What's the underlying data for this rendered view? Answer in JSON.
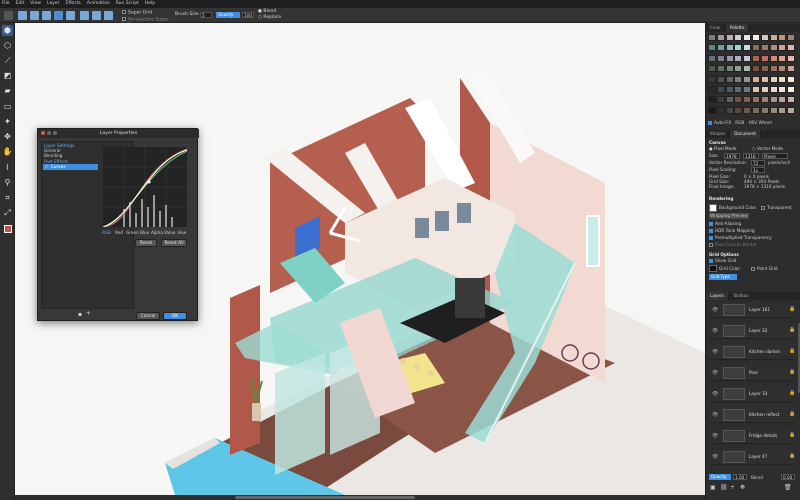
{
  "menu": [
    "File",
    "Edit",
    "View",
    "Layer",
    "Effects",
    "Animation",
    "Run Script",
    "Help"
  ],
  "options": {
    "super_grid": "Super Grid",
    "perspective_super_grid": "Perspective Super Grid",
    "brush_size_label": "Brush Size",
    "brush_size_value": "5",
    "opacity_label": "Opacity",
    "opacity_value": "100",
    "blend_label": "Blend",
    "replace_label": "Replace"
  },
  "panel": {
    "top_tabs": [
      "Color",
      "Palette"
    ],
    "color_modes": {
      "autofill": "Auto-Fill",
      "rgb": "RGB",
      "hsv": "HSV Wheel"
    },
    "mid_tabs": [
      "Shapes",
      "Document"
    ],
    "canvas_header": "Canvas",
    "pixel_mode": "Pixel Mode",
    "vector_mode": "Vector Mode",
    "size_label": "Size:",
    "size_w": "1978",
    "size_h": "1316",
    "size_unit": "Pixels",
    "vector_res_label": "Vector Resolution:",
    "vector_res_value": "72",
    "vector_res_unit": "pixels/inch",
    "pixel_scaling_label": "Pixel Scaling:",
    "pixel_scaling_value": "1x",
    "pixel_size_label": "Pixel Size:",
    "pixel_size_value": "0 × 0 pixels",
    "grid_size_label": "Grid Size:",
    "grid_size_value": "490 × 393 Pixels",
    "final_image_label": "Final Image:",
    "final_image_value": "1978 × 1316 pixels",
    "rendering_header": "Rendering",
    "bg_color": "Background Color",
    "transparent": "Transparent",
    "wrapping_preview": "Wrapping Preview",
    "anti_aliasing": "Anti-Aliasing",
    "hdr_tone": "HDR Tone Mapping",
    "premultiplied": "Premultiplied Transparency",
    "pixel_canvas_border": "Pixel Canvas Border",
    "grid_header": "Grid Options",
    "show_grid": "Show Grid",
    "grid_color": "Grid Color",
    "paint_grid": "Paint Grid",
    "grid_type": "Grid Type",
    "layer_tabs": [
      "Layers",
      "Toolbox"
    ],
    "layers": [
      "Layer 161",
      "Layer 33",
      "Kitchen darken",
      "Pool",
      "Layer 33",
      "Kitchen reflect",
      "Fridge details",
      "Layer 47"
    ],
    "bottom_opacity_label": "Opacity",
    "bottom_opacity_value": "1.00",
    "bottom_blend_label": "Blend",
    "bottom_blend_value": "0.00"
  },
  "dialog": {
    "title": "Layer Properties",
    "section": "Layer Settings",
    "items": [
      "General",
      "Blending"
    ],
    "post_effects": "Post Effects",
    "curves": "Curves",
    "channels": [
      "RGB",
      "Red",
      "Green",
      "Blue",
      "Alpha",
      "Value",
      "Hue"
    ],
    "reset": "Reset",
    "reset_all": "Reset All",
    "cancel": "Cancel",
    "ok": "OK"
  },
  "colors": {
    "accent": "#3f8fe0",
    "brick": "#b0594a",
    "glass": "#8fd6cc",
    "pool": "#5ec6e6",
    "floor": "#7a4a3e"
  }
}
